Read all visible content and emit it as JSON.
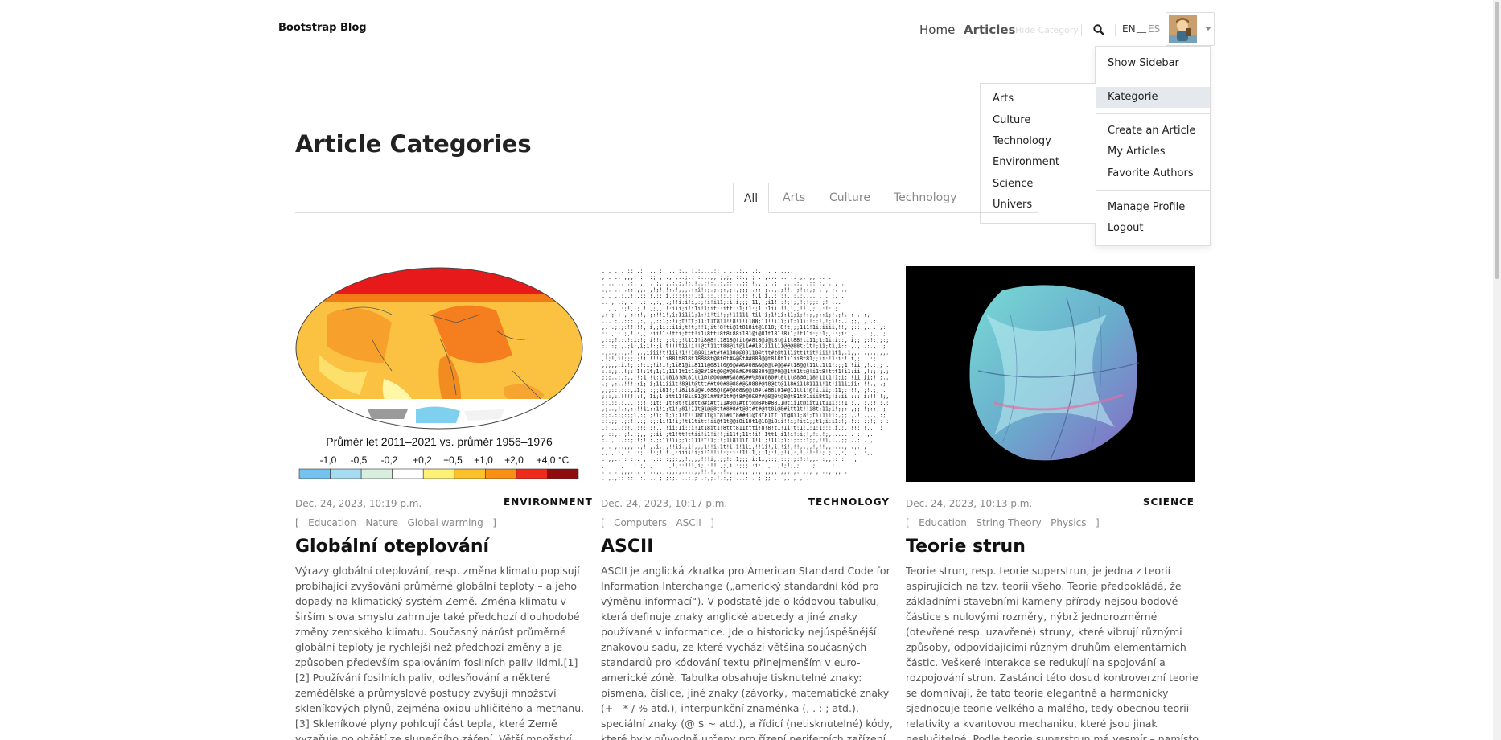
{
  "navbar": {
    "brand": "Bootstrap Blog",
    "home": "Home",
    "articles": "Articles",
    "hide_category": "Hide Category",
    "lang_en": "EN",
    "lang_sep": "__",
    "lang_es": "ES"
  },
  "user_menu": {
    "show_sidebar": "Show Sidebar",
    "kategorie": "Kategorie",
    "create_article": "Create an Article",
    "my_articles": "My Articles",
    "favorite_authors": "Favorite Authors",
    "manage_profile": "Manage Profile",
    "logout": "Logout"
  },
  "category_menu": [
    "Arts",
    "Culture",
    "Technology",
    "Environment",
    "Science",
    "Univers"
  ],
  "page": {
    "title": "Article Categories",
    "tabs": [
      "All",
      "Arts",
      "Culture",
      "Technology"
    ]
  },
  "map_legend": {
    "caption": "Průměr let 2011–2021 vs. průměr 1956–1976",
    "ticks": [
      "-1,0",
      "-0,5",
      "-0,2",
      "+0,2",
      "+0,5",
      "+1,0",
      "+2,0",
      "+4,0 °C"
    ],
    "colors": [
      "#73c2ef",
      "#a6dcf2",
      "#d8efe0",
      "#ffffff",
      "#fff176",
      "#fdc22a",
      "#f99014",
      "#ee2a1b",
      "#8e0c0c"
    ]
  },
  "articles": [
    {
      "date": "Dec. 24, 2023, 10:19 p.m.",
      "category": "ENVIRONMENT",
      "tags": [
        "Education",
        "Nature",
        "Global warming"
      ],
      "title": "Globální oteplování",
      "excerpt": "Výrazy globální oteplování, resp. změna klimatu popisují probíhající zvyšování průměrné globální teploty – a jeho dopady na klimatický systém Země. Změna klimatu v širším slova smyslu zahrnuje také předchozí dlouhodobé změny zemského klimatu. Současný nárůst průměrné globální teploty je rychlejší než předchozí změny a je způsoben především spalováním fosilních paliv lidmi.[1][2] Používání fosilních paliv, odlesňování a některé zemědělské a průmyslové postupy zvyšují množství skleníkových plynů, zejména oxidu uhličitého a methanu.[3] Skleníkové plyny pohlcují část tepla, které Země vyzařuje po ohřátí ze slunečního záření. Větší množství těchto plynů zachycuje více"
    },
    {
      "date": "Dec. 24, 2023, 10:17 p.m.",
      "category": "TECHNOLOGY",
      "tags": [
        "Computers",
        "ASCII"
      ],
      "title": "ASCII",
      "excerpt": "ASCII je anglická zkratka pro American Standard Code for Information Interchange („americký standardní kód pro výměnu informací“). V podstatě jde o kódovou tabulku, která definuje znaky anglické abecedy a jiné znaky používané v informatice. Jde o historicky nejúspěšnější znakovou sadu, ze které vychází většina současných standardů pro kódování textu přinejmenším v euro-americké zóně. Tabulka obsahuje tisknutelné znaky: písmena, číslice, jiné znaky (závorky, matematické znaky (+ - * / % atd.), interpunkční znaménka (, . : ; atd.), speciální znaky (@ $ ~ atd.), a řídicí (netisknutelné) kódy, které byly původně určeny pro řízení periferních zařízení (např. tiskárny nebo dálnopisu)."
    },
    {
      "date": "Dec. 24, 2023, 10:13 p.m.",
      "category": "SCIENCE",
      "tags": [
        "Education",
        "String Theory",
        "Physics"
      ],
      "title": "Teorie strun",
      "excerpt": "Teorie strun, resp. teorie superstrun, je jedna z teorií aspirujících na tzv. teorii všeho. Teorie předpokládá, že základními stavebními kameny přírody nejsou bodové částice s nulovými rozměry, nýbrž jednorozměrné (otevřené resp. uzavřené) struny, které vibrují různými způsoby, odpovídajícími různým druhům elementárních částic. Veškeré interakce se redukují na spojování a rozpojování strun. Zastánci této dosud kontroverzní teorie se domnívají, že tato teorie elegantně a harmonicky sjednocuje teorie velkého a malého, tedy obecnou teorii relativity a kvantovou mechaniku, které jsou jinak neslučitelné. Podle teorie superstrun má vesmír – namísto známých čtyř rozměrů"
    }
  ]
}
